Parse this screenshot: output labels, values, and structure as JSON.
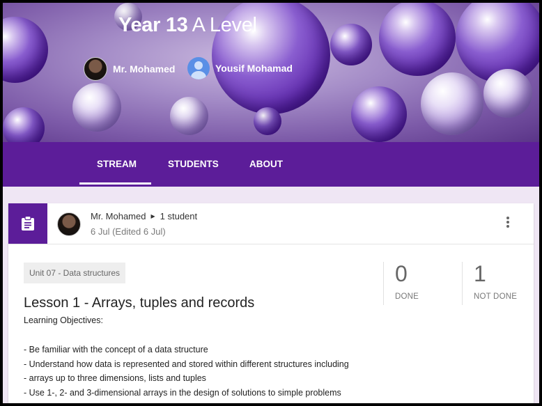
{
  "banner": {
    "title_bold": "Year 13",
    "title_rest": "A Level",
    "teachers": [
      {
        "name": "Mr. Mohamed"
      },
      {
        "name": "Yousif Mohamad"
      }
    ]
  },
  "nav": {
    "tabs": [
      {
        "label": "STREAM",
        "active": true
      },
      {
        "label": "STUDENTS"
      },
      {
        "label": "ABOUT"
      }
    ]
  },
  "post": {
    "author": "Mr. Mohamed",
    "audience": "1 student",
    "date": "6 Jul (Edited 6 Jul)",
    "topic": "Unit 07 - Data structures",
    "title": "Lesson 1 - Arrays, tuples and records",
    "objectives_heading": "Learning Objectives:",
    "objectives": [
      "- Be familiar with the concept of a data structure",
      "- Understand how data is represented and stored within different structures including",
      "- arrays up to three dimensions, lists and tuples",
      "- Use 1-, 2- and 3-dimensional arrays in the design of solutions to simple problems"
    ],
    "stats": {
      "done_count": "0",
      "done_label": "DONE",
      "not_done_count": "1",
      "not_done_label": "NOT DONE"
    }
  },
  "colors": {
    "primary": "#5c1d99",
    "page_bg": "#efe6f4"
  },
  "icons": [
    "assignment-icon",
    "more-vert-icon",
    "arrow-right-icon"
  ]
}
